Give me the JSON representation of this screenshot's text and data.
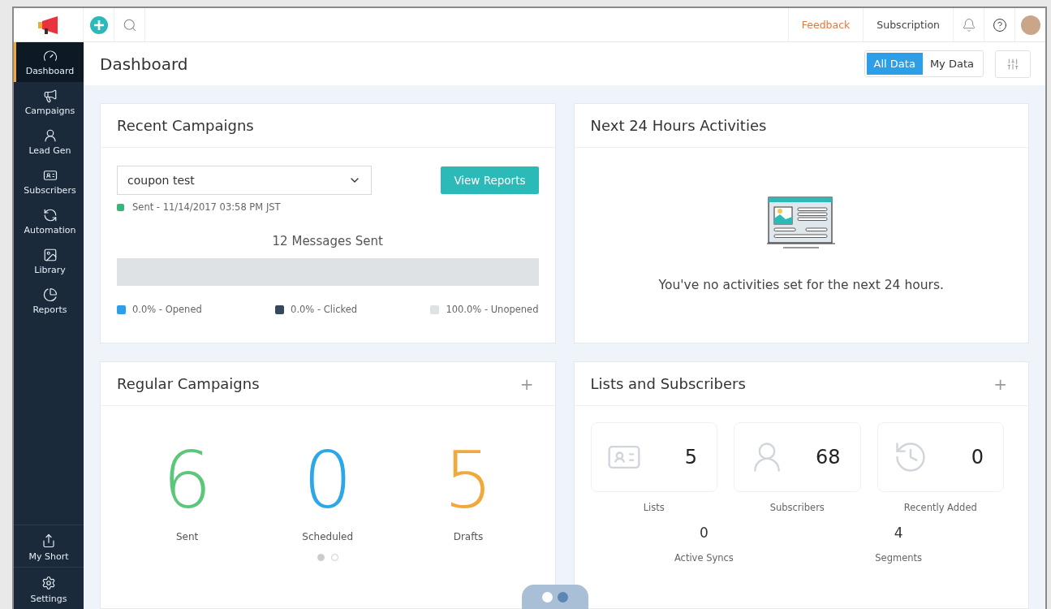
{
  "topbar": {
    "feedback": "Feedback",
    "subscription": "Subscription"
  },
  "sidebar": {
    "items": [
      {
        "label": "Dashboard",
        "selected": true
      },
      {
        "label": "Campaigns",
        "selected": false
      },
      {
        "label": "Lead Gen",
        "selected": false
      },
      {
        "label": "Subscribers",
        "selected": false
      },
      {
        "label": "Automation",
        "selected": false
      },
      {
        "label": "Library",
        "selected": false
      },
      {
        "label": "Reports",
        "selected": false
      }
    ],
    "bottom": [
      {
        "label": "My Short"
      },
      {
        "label": "Settings"
      }
    ]
  },
  "header": {
    "title": "Dashboard",
    "toggle": [
      {
        "label": "All Data",
        "selected": true
      },
      {
        "label": "My Data",
        "selected": false
      }
    ]
  },
  "recent_campaigns": {
    "title": "Recent Campaigns",
    "select_value": "coupon test",
    "button": "View Reports",
    "status": {
      "text": "Sent - 11/14/2017 03:58 PM JST",
      "color": "#3bb37f"
    },
    "messages": "12 Messages Sent",
    "legend": [
      {
        "label": "0.0% - Opened",
        "color": "#2d9ee8",
        "level": 0
      },
      {
        "label": "0.0% - Clicked",
        "color": "#34495e",
        "level": 0
      },
      {
        "label": "100.0% - Unopened",
        "color": "#dfe2e5",
        "level": 1
      }
    ]
  },
  "activities": {
    "title": "Next 24 Hours Activities",
    "empty": "You've no activities set for the next 24 hours."
  },
  "regular_campaigns": {
    "title": "Regular Campaigns",
    "add": "+",
    "stats": [
      {
        "value": "6",
        "label": "Sent",
        "color": "#5cc77a"
      },
      {
        "value": "0",
        "label": "Scheduled",
        "color": "#2ea7e8"
      },
      {
        "value": "5",
        "label": "Drafts",
        "color": "#f2a93b"
      }
    ],
    "pages": [
      {
        "selected": true
      },
      {
        "selected": false
      }
    ]
  },
  "lists": {
    "title": "Lists and Subscribers",
    "add": "+",
    "tiles": [
      {
        "value": "5",
        "label": "Lists"
      },
      {
        "value": "68",
        "label": "Subscribers"
      },
      {
        "value": "0",
        "label": "Recently Added"
      }
    ],
    "extra": [
      {
        "value": "0",
        "label": "Active Syncs"
      },
      {
        "value": "4",
        "label": "Segments"
      }
    ]
  },
  "bottom_toggle": [
    {
      "selected": false
    },
    {
      "selected": true
    }
  ]
}
